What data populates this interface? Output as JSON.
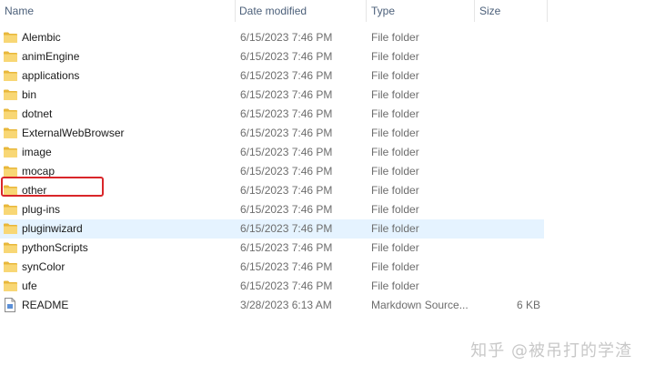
{
  "header": {
    "name_label": "Name",
    "date_label": "Date modified",
    "type_label": "Type",
    "size_label": "Size",
    "sort_indicator": "^"
  },
  "rows": [
    {
      "name": "Alembic",
      "date": "6/15/2023 7:46 PM",
      "type": "File folder",
      "size": "",
      "icon": "folder-icon"
    },
    {
      "name": "animEngine",
      "date": "6/15/2023 7:46 PM",
      "type": "File folder",
      "size": "",
      "icon": "folder-icon"
    },
    {
      "name": "applications",
      "date": "6/15/2023 7:46 PM",
      "type": "File folder",
      "size": "",
      "icon": "folder-icon"
    },
    {
      "name": "bin",
      "date": "6/15/2023 7:46 PM",
      "type": "File folder",
      "size": "",
      "icon": "folder-icon"
    },
    {
      "name": "dotnet",
      "date": "6/15/2023 7:46 PM",
      "type": "File folder",
      "size": "",
      "icon": "folder-icon"
    },
    {
      "name": "ExternalWebBrowser",
      "date": "6/15/2023 7:46 PM",
      "type": "File folder",
      "size": "",
      "icon": "folder-icon"
    },
    {
      "name": "image",
      "date": "6/15/2023 7:46 PM",
      "type": "File folder",
      "size": "",
      "icon": "folder-icon"
    },
    {
      "name": "mocap",
      "date": "6/15/2023 7:46 PM",
      "type": "File folder",
      "size": "",
      "icon": "folder-icon"
    },
    {
      "name": "other",
      "date": "6/15/2023 7:46 PM",
      "type": "File folder",
      "size": "",
      "icon": "folder-icon"
    },
    {
      "name": "plug-ins",
      "date": "6/15/2023 7:46 PM",
      "type": "File folder",
      "size": "",
      "icon": "folder-icon"
    },
    {
      "name": "pluginwizard",
      "date": "6/15/2023 7:46 PM",
      "type": "File folder",
      "size": "",
      "icon": "folder-icon"
    },
    {
      "name": "pythonScripts",
      "date": "6/15/2023 7:46 PM",
      "type": "File folder",
      "size": "",
      "icon": "folder-icon"
    },
    {
      "name": "synColor",
      "date": "6/15/2023 7:46 PM",
      "type": "File folder",
      "size": "",
      "icon": "folder-icon"
    },
    {
      "name": "ufe",
      "date": "6/15/2023 7:46 PM",
      "type": "File folder",
      "size": "",
      "icon": "folder-icon"
    },
    {
      "name": "README",
      "date": "3/28/2023 6:13 AM",
      "type": "Markdown Source...",
      "size": "6 KB",
      "icon": "markdown-file-icon"
    }
  ],
  "hovered_row": "pluginwizard",
  "highlighted_row": "other",
  "colors": {
    "folder": "#f8d775",
    "folder_dark": "#e8b73a",
    "hover": "#e5f3ff",
    "highlight_border": "#d9262a"
  },
  "watermark": "知乎 @被吊打的学渣"
}
